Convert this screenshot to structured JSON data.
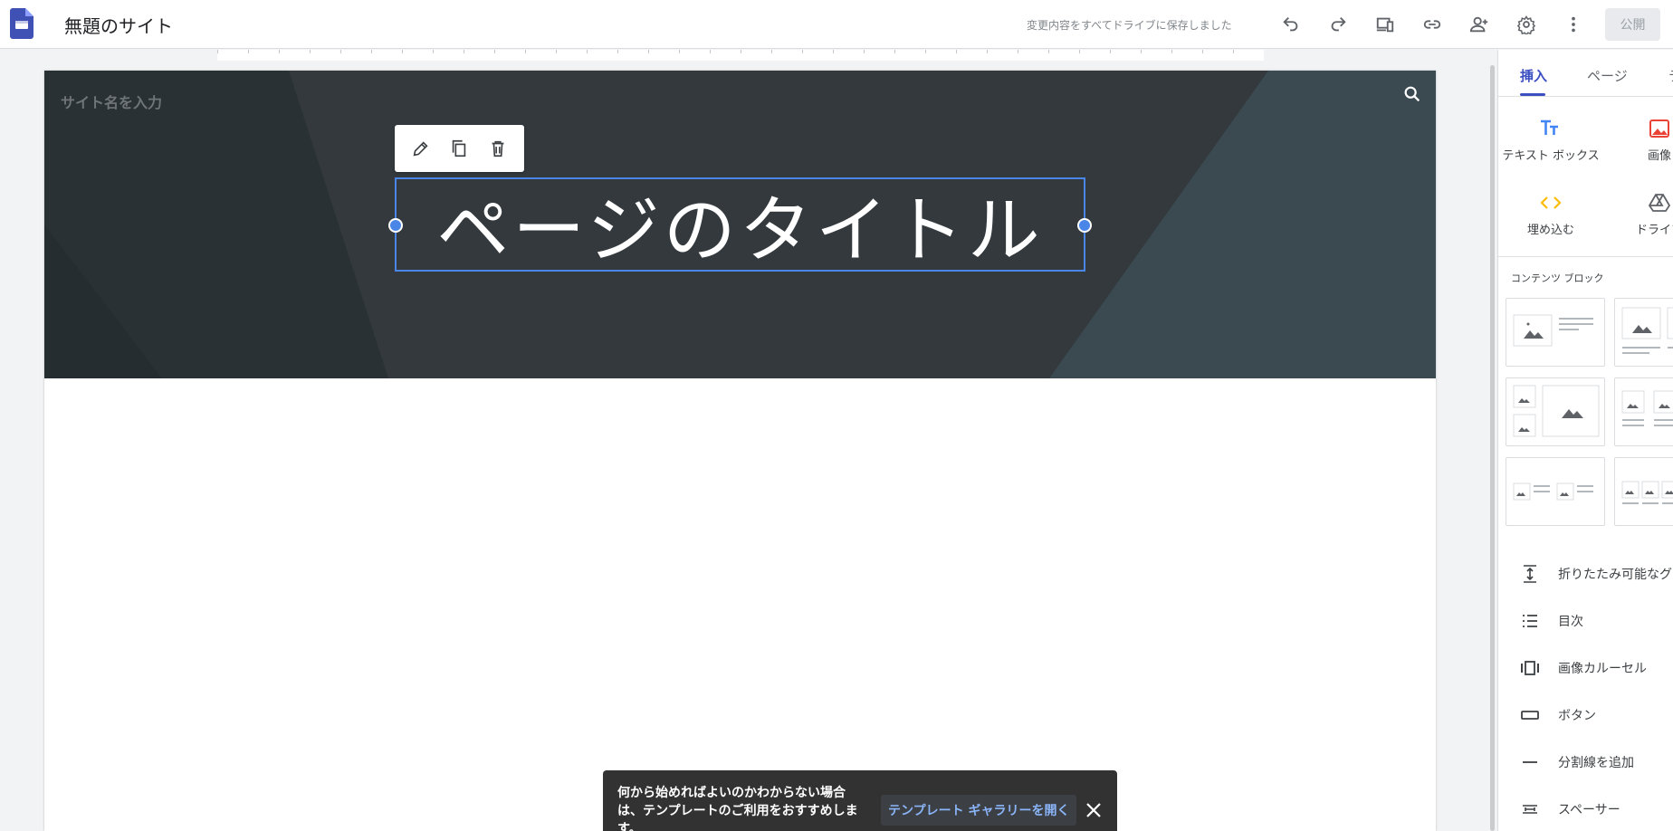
{
  "header": {
    "site_title": "無題のサイト",
    "save_status": "変更内容をすべてドライブに保存しました",
    "publish_label": "公開"
  },
  "page": {
    "site_name_placeholder": "サイト名を入力",
    "page_title": "ページのタイトル"
  },
  "snackbar": {
    "message": "何から始めればよいのかわからない場合は、テンプレートのご利用をおすすめします。",
    "action_label": "テンプレート ギャラリーを開く"
  },
  "panel": {
    "tabs": [
      {
        "label": "挿入"
      },
      {
        "label": "ページ"
      },
      {
        "label": "テ"
      }
    ],
    "insert_items": [
      {
        "label": "テキスト ボックス",
        "icon": "text-box-icon"
      },
      {
        "label": "画像",
        "icon": "image-icon"
      },
      {
        "label": "埋め込む",
        "icon": "embed-icon"
      },
      {
        "label": "ドライブ",
        "icon": "drive-icon"
      }
    ],
    "content_blocks_label": "コンテンツ ブロック",
    "list_items": [
      {
        "label": "折りたたみ可能なグループ",
        "icon": "collapsible-group-icon"
      },
      {
        "label": "目次",
        "icon": "table-of-contents-icon"
      },
      {
        "label": "画像カルーセル",
        "icon": "image-carousel-icon"
      },
      {
        "label": "ボタン",
        "icon": "button-icon"
      },
      {
        "label": "分割線を追加",
        "icon": "divider-icon"
      },
      {
        "label": "スペーサー",
        "icon": "spacer-icon"
      }
    ]
  },
  "colors": {
    "accent": "#3c4fc2",
    "selection": "#4a86e8",
    "banner": "#2d3538",
    "link": "#8ab4f8"
  }
}
